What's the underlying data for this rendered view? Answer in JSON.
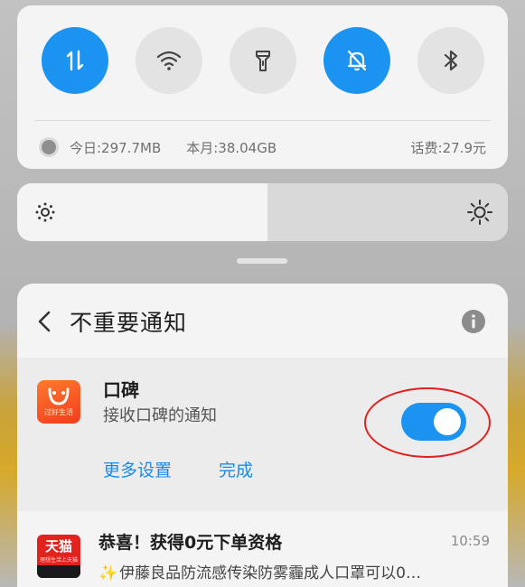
{
  "quick_settings": {
    "toggles": [
      {
        "name": "mobile-data",
        "icon": "data-transfer-icon",
        "state": "on"
      },
      {
        "name": "wifi",
        "icon": "wifi-icon",
        "state": "off"
      },
      {
        "name": "flashlight",
        "icon": "flashlight-icon",
        "state": "off"
      },
      {
        "name": "silent",
        "icon": "bell-off-icon",
        "state": "on"
      },
      {
        "name": "bluetooth",
        "icon": "bluetooth-icon",
        "state": "off"
      }
    ],
    "data_usage": {
      "today": "今日:297.7MB",
      "month": "本月:38.04GB",
      "fee": "话费:27.9元"
    }
  },
  "brightness": {
    "level_fraction": 0.51,
    "low_icon": "brightness-low-icon",
    "high_icon": "brightness-high-icon"
  },
  "notification_settings": {
    "title": "不重要通知",
    "app": {
      "name": "口碑",
      "description": "接收口碑的通知",
      "icon_tag": "过好生活",
      "enabled": true
    },
    "more_settings_label": "更多设置",
    "done_label": "完成"
  },
  "message": {
    "app_icon_text": "天猫",
    "app_icon_sub": "理想生活上天猫",
    "title": "恭喜！获得0元下单资格",
    "time": "10:59",
    "spark": "✨",
    "body": "伊藤良品防流感传染防雾霾成人口罩可以0…"
  },
  "colors": {
    "accent": "#1b93f0",
    "annotation_ring": "#e0201f",
    "koubei": "#f43b1e",
    "tmall": "#e4221d"
  }
}
